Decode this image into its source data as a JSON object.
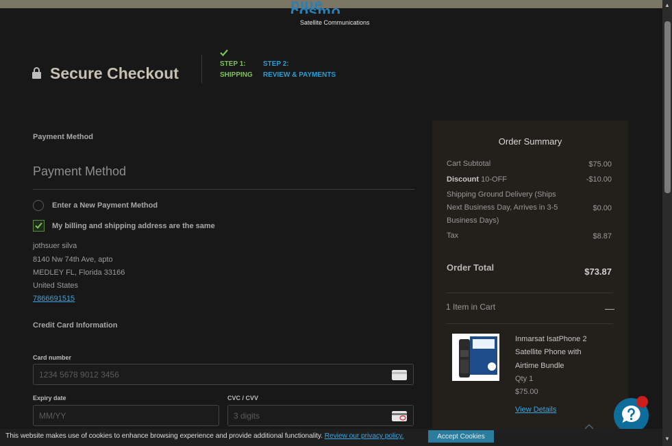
{
  "header": {
    "brand_logo": "blue cosmo",
    "brand_tagline": "Satellite Communications",
    "title": "Secure Checkout",
    "lock_icon": "lock-icon",
    "step1": {
      "icon": "check-icon",
      "line1": "STEP 1:",
      "line2": "SHIPPING"
    },
    "step2": {
      "line1": "STEP 2:",
      "line2": "REVIEW & PAYMENTS"
    }
  },
  "payment": {
    "section_label": "Payment Method",
    "heading": "Payment Method",
    "new_method_label": "Enter a New Payment Method",
    "same_address_label": "My billing and shipping address are the same",
    "same_address_checked": true,
    "address": {
      "name": "jothsuer silva",
      "street": "8140 Nw 74th Ave, apto",
      "city_line": "MEDLEY FL, Florida 33166",
      "country": "United States",
      "phone": "7866691515"
    },
    "credit_card_label": "Credit Card Information",
    "card_number": {
      "label": "Card number",
      "placeholder": "1234 5678 9012 3456"
    },
    "expiry": {
      "label": "Expiry date",
      "placeholder": "MM/YY"
    },
    "cvc": {
      "label": "CVC / CVV",
      "placeholder": "3 digits"
    }
  },
  "summary": {
    "title": "Order Summary",
    "subtotal_label": "Cart Subtotal",
    "subtotal_value": "$75.00",
    "discount_label": "Discount",
    "discount_code": "10-OFF",
    "discount_value": "-$10.00",
    "shipping_line1": "Shipping Ground Delivery (Ships",
    "shipping_line2": "Next Business Day, Arrives in 3-5",
    "shipping_line3": "Business Days)",
    "shipping_value": "$0.00",
    "tax_label": "Tax",
    "tax_value": "$8.87",
    "order_total_label": "Order Total",
    "order_total_value": "$73.87",
    "items_label": "1 Item in Cart",
    "collapse_glyph": "—",
    "item": {
      "name_line1": "Inmarsat IsatPhone 2",
      "name_line2": "Satellite Phone with",
      "name_line3": "Airtime Bundle",
      "qty": "Qty 1",
      "price": "$75.00",
      "view_details": "View Details"
    }
  },
  "cookie": {
    "text": "This website makes use of cookies to enhance browsing experience and provide additional functionality.",
    "link": "Review our privacy policy.",
    "button": "Accept Cookies"
  },
  "colors": {
    "background": "#181818",
    "accent_green": "#7ec25a",
    "accent_blue": "#2a9fd6",
    "link": "#3da5e0",
    "summary_bg": "#231f1a",
    "help_button": "#0e6d9a"
  }
}
